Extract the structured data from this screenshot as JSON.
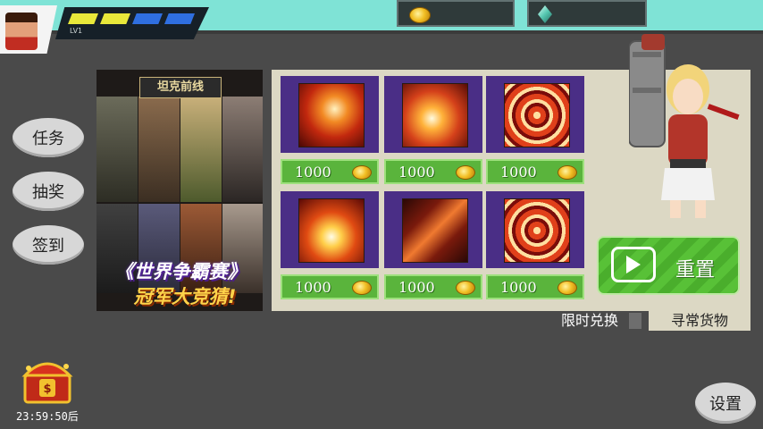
{
  "player": {
    "level_label": "LV1"
  },
  "resources": {
    "coin_icon": "gold-coin-icon",
    "gem_icon": "diamond-gem-icon"
  },
  "menu": {
    "task": "任务",
    "lottery": "抽奖",
    "checkin": "签到"
  },
  "banner": {
    "title": "坦克前线",
    "slogan_line1": "《世界争霸赛》",
    "slogan_line2": "冠军大竞猜!"
  },
  "shop": {
    "items": [
      {
        "icon": "tornado-skill-icon",
        "price": "1000"
      },
      {
        "icon": "explosion-skill-icon",
        "price": "1000"
      },
      {
        "icon": "vortex-skill-icon",
        "price": "1000"
      },
      {
        "icon": "lightning-skill-icon",
        "price": "1000"
      },
      {
        "icon": "claw-slash-skill-icon",
        "price": "1000"
      },
      {
        "icon": "vortex-skill-icon",
        "price": "1000"
      }
    ],
    "reset_label": "重置"
  },
  "tabs": {
    "limited": "限时兑换",
    "normal": "寻常货物"
  },
  "chest": {
    "timer": "23:59:50后"
  },
  "settings_label": "设置",
  "colors": {
    "topbar": "#7fe3d6",
    "panel": "#dcd8c4",
    "item_bg": "#4a2e86",
    "price_green": "#5ab43c"
  }
}
